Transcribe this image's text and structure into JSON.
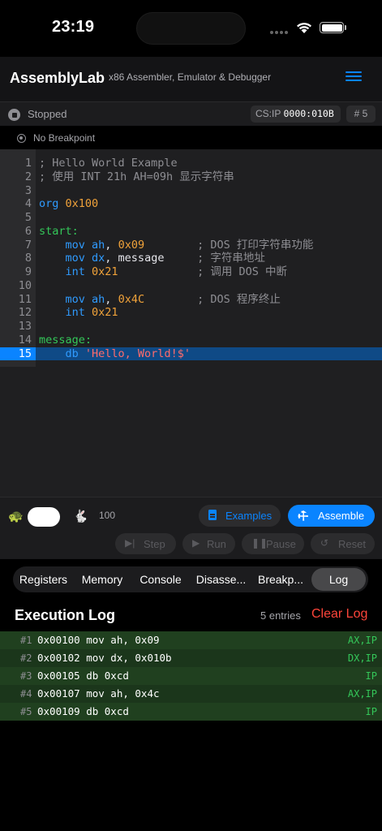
{
  "status_bar": {
    "time": "23:19"
  },
  "navbar": {
    "title": "AssemblyLab",
    "subtitle": "x86 Assembler, Emulator & Debugger"
  },
  "state": {
    "status": "Stopped",
    "csip_label": "CS:IP",
    "csip_value": "0000:010B",
    "step_count": "# 5",
    "breakpoint": "No Breakpoint"
  },
  "editor": {
    "current_line": 15,
    "lines": [
      {
        "n": "1",
        "tokens": [
          {
            "t": "; Hello World Example",
            "c": "comment"
          }
        ]
      },
      {
        "n": "2",
        "tokens": [
          {
            "t": "; 使用 INT 21h AH=09h 显示字符串",
            "c": "comment"
          }
        ]
      },
      {
        "n": "3",
        "tokens": []
      },
      {
        "n": "4",
        "tokens": [
          {
            "t": "org ",
            "c": "kw"
          },
          {
            "t": "0x100",
            "c": "num"
          }
        ]
      },
      {
        "n": "5",
        "tokens": []
      },
      {
        "n": "6",
        "tokens": [
          {
            "t": "start:",
            "c": "label"
          }
        ]
      },
      {
        "n": "7",
        "tokens": [
          {
            "t": "    mov ",
            "c": "kw"
          },
          {
            "t": "ah",
            "c": "kw"
          },
          {
            "t": ", ",
            "c": "plain"
          },
          {
            "t": "0x09",
            "c": "num"
          },
          {
            "t": "        ; DOS 打印字符串功能",
            "c": "comment"
          }
        ]
      },
      {
        "n": "8",
        "tokens": [
          {
            "t": "    mov ",
            "c": "kw"
          },
          {
            "t": "dx",
            "c": "kw"
          },
          {
            "t": ", message",
            "c": "plain"
          },
          {
            "t": "     ; 字符串地址",
            "c": "comment"
          }
        ]
      },
      {
        "n": "9",
        "tokens": [
          {
            "t": "    int ",
            "c": "kw"
          },
          {
            "t": "0x21",
            "c": "num"
          },
          {
            "t": "            ; 调用 DOS 中断",
            "c": "comment"
          }
        ]
      },
      {
        "n": "10",
        "tokens": []
      },
      {
        "n": "11",
        "tokens": [
          {
            "t": "    mov ",
            "c": "kw"
          },
          {
            "t": "ah",
            "c": "kw"
          },
          {
            "t": ", ",
            "c": "plain"
          },
          {
            "t": "0x4C",
            "c": "num"
          },
          {
            "t": "        ; DOS 程序终止",
            "c": "comment"
          }
        ]
      },
      {
        "n": "12",
        "tokens": [
          {
            "t": "    int ",
            "c": "kw"
          },
          {
            "t": "0x21",
            "c": "num"
          }
        ]
      },
      {
        "n": "13",
        "tokens": []
      },
      {
        "n": "14",
        "tokens": [
          {
            "t": "message:",
            "c": "label"
          }
        ]
      },
      {
        "n": "15",
        "tokens": [
          {
            "t": "    db ",
            "c": "kw"
          },
          {
            "t": "'Hello, World!$'",
            "c": "str"
          }
        ]
      }
    ]
  },
  "controls": {
    "speed": "100",
    "speed_level": 0.5,
    "examples_label": "Examples",
    "assemble_label": "Assemble",
    "step_label": "Step",
    "run_label": "Run",
    "pause_label": "Pause",
    "reset_label": "Reset"
  },
  "tabs": [
    "Registers",
    "Memory",
    "Console",
    "Disasse...",
    "Breakp...",
    "Log"
  ],
  "active_tab": "Log",
  "log": {
    "title": "Execution Log",
    "count": "5 entries",
    "clear_label": "Clear Log",
    "entries": [
      {
        "idx": "#1",
        "text": "0x00100 mov ah, 0x09",
        "regs": "AX,IP"
      },
      {
        "idx": "#2",
        "text": "0x00102 mov dx, 0x010b",
        "regs": "DX,IP"
      },
      {
        "idx": "#3",
        "text": "0x00105 db 0xcd",
        "regs": "IP"
      },
      {
        "idx": "#4",
        "text": "0x00107 mov ah, 0x4c",
        "regs": "AX,IP"
      },
      {
        "idx": "#5",
        "text": "0x00109 db 0xcd",
        "regs": "IP"
      }
    ]
  }
}
